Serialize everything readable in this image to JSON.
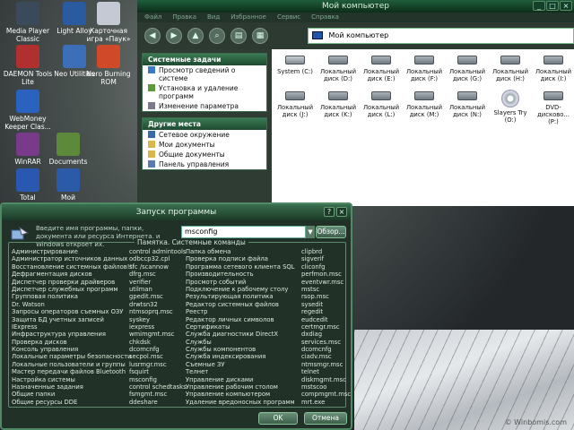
{
  "desktop": {
    "icons": [
      {
        "label": "Media Player Classic",
        "color": "#3b4a5a"
      },
      {
        "label": "Light Alloy",
        "color": "#2a5aa0"
      },
      {
        "label": "Карточная игра «Паук»",
        "color": "#c5c9d4"
      },
      {
        "label": "DAEMON Tools Lite",
        "color": "#b03030"
      },
      {
        "label": "Neo Utilities",
        "color": "#3c6fb8"
      },
      {
        "label": "Nero Burning ROM",
        "color": "#d04a2a"
      },
      {
        "label": "WebMoney Keeper Clas...",
        "color": "#2a62c0"
      },
      {
        "label": "WinRAR",
        "color": "#7a3a8a"
      },
      {
        "label": "Documents",
        "color": "#5c8a3a"
      },
      {
        "label": "Total",
        "color": "#2a58b0"
      },
      {
        "label": "Мой",
        "color": "#2a5aa8"
      }
    ],
    "watermark": "© Winbomis.com"
  },
  "explorer": {
    "title": "Мой компьютер",
    "menu": [
      "Файл",
      "Правка",
      "Вид",
      "Избранное",
      "Сервис",
      "Справка"
    ],
    "address": "Мой компьютер",
    "system_tasks": {
      "header": "Системные задачи",
      "items": [
        "Просмотр сведений о системе",
        "Установка и удаление программ",
        "Изменение параметра"
      ]
    },
    "other_places": {
      "header": "Другие места",
      "items": [
        "Сетевое окружение",
        "Мои документы",
        "Общие документы",
        "Панель управления"
      ]
    },
    "drives": [
      {
        "label": "System (C:)",
        "type": "sys"
      },
      {
        "label": "Локальный диск (D:)",
        "type": "hdd"
      },
      {
        "label": "Локальный диск (E:)",
        "type": "hdd"
      },
      {
        "label": "Локальный диск (F:)",
        "type": "hdd"
      },
      {
        "label": "Локальный диск (G:)",
        "type": "hdd"
      },
      {
        "label": "Локальный диск (H:)",
        "type": "hdd"
      },
      {
        "label": "Локальный диск (I:)",
        "type": "hdd"
      },
      {
        "label": "Локальный диск (J:)",
        "type": "hdd"
      },
      {
        "label": "Локальный диск (K:)",
        "type": "hdd"
      },
      {
        "label": "Локальный диск (L:)",
        "type": "hdd"
      },
      {
        "label": "Локальный диск (M:)",
        "type": "hdd"
      },
      {
        "label": "Локальный диск (N:)",
        "type": "hdd"
      },
      {
        "label": "Slayers Try (O:)",
        "type": "dvd"
      },
      {
        "label": "DVD-дисково... (P:)",
        "type": "hdd"
      }
    ]
  },
  "run_dialog": {
    "title": "Запуск программы",
    "description": "Введите имя программы, папки, документа или ресурса Интернета, и Windows откроет их.",
    "input_value": "msconfig",
    "browse_label": "Обзор...",
    "memo_title": "Памятка. Системные команды",
    "columns": [
      [
        "Администрирование",
        "Администратор источников данных",
        "Восстановление системных файлов!!!",
        "Дефрагментация дисков",
        "Диспетчер проверки драйверов",
        "Диспетчер служебных программ",
        "Групповая политика",
        "Dr. Watson",
        "Запросы операторов съемных ОЗУ",
        "Защита БД учетных записей",
        "IExpress",
        "Инфраструктура управления",
        "Проверка дисков",
        "Консоль управления",
        "Локальные параметры безопасности",
        "Локальные пользователи и группы",
        "Мастер передачи файлов Bluetooth",
        "Настройка системы",
        "Назначенные задания",
        "Общие папки",
        "Общие ресурсы DDE"
      ],
      [
        "control admintools",
        "odbccp32.cpl",
        "sfc /scannow",
        "dfrg.msc",
        "verifier",
        "utilman",
        "gpedit.msc",
        "drwtsn32",
        "ntmsoprq.msc",
        "syskey",
        "iexpress",
        "wmimgmt.msc",
        "chkdsk",
        "dcomcnfg",
        "secpol.msc",
        "lusrmgr.msc",
        "fsquirt",
        "msconfig",
        "control schedtasks",
        "fsmgmt.msc",
        "ddeshare"
      ],
      [
        "Папка обмена",
        "Проверка подписи файла",
        "Программа сетевого клиента SQL",
        "Производительность",
        "Просмотр событий",
        "Подключение к рабочему столу",
        "Результирующая политика",
        "Редактор системных файлов",
        "Реестр",
        "Редактор личных символов",
        "Сертификаты",
        "Служба диагностики DirectX",
        "Службы",
        "Службы компонентов",
        "Служба индексирования",
        "Съемные ЗУ",
        "Телнет",
        "Управление дисками",
        "Управление рабочим столом",
        "Управление компьютером",
        "Удаление вредоносных программ"
      ],
      [
        "clipbrd",
        "sigverif",
        "cliconfg",
        "perfmon.msc",
        "eventvwr.msc",
        "mstsc",
        "rsop.msc",
        "sysedit",
        "regedit",
        "eudcedit",
        "certmgr.msc",
        "dxdiag",
        "services.msc",
        "dcomcnfg",
        "ciadv.msc",
        "ntmsmgr.msc",
        "telnet",
        "diskmgmt.msc",
        "mstscoo",
        "compmgmt.msc",
        "mrt.exe"
      ]
    ],
    "ok_label": "OK",
    "cancel_label": "Отмена"
  }
}
